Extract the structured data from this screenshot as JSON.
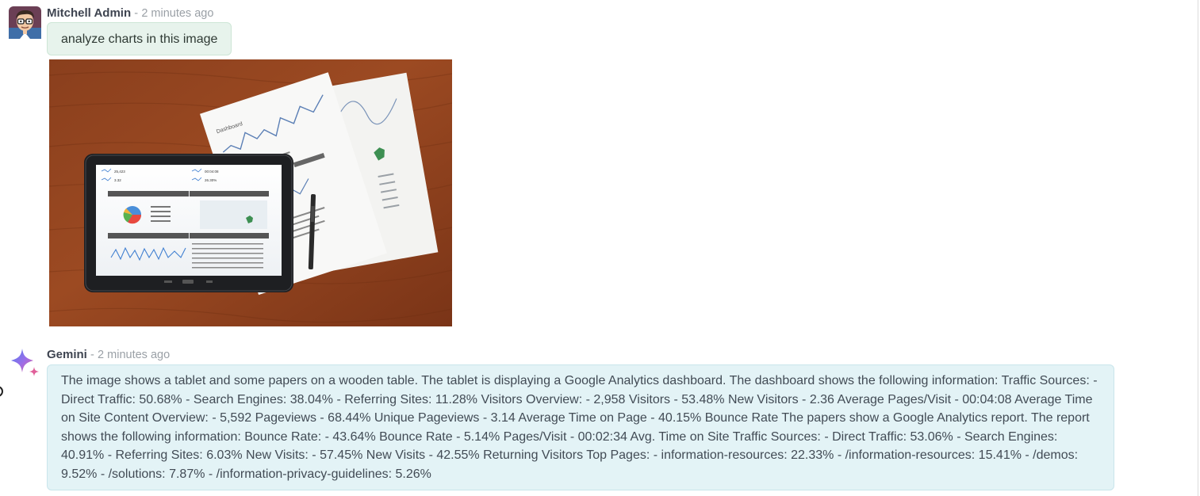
{
  "messages": {
    "user": {
      "author": "Mitchell Admin",
      "separator": "-",
      "time": "2 minutes ago",
      "text": "analyze charts in this image"
    },
    "assistant": {
      "author": "Gemini",
      "separator": "-",
      "time": "2 minutes ago",
      "text": "The image shows a tablet and some papers on a wooden table. The tablet is displaying a Google Analytics dashboard. The dashboard shows the following information: Traffic Sources: - Direct Traffic: 50.68% - Search Engines: 38.04% - Referring Sites: 11.28% Visitors Overview: - 2,958 Visitors - 53.48% New Visitors - 2.36 Average Pages/Visit - 00:04:08 Average Time on Site Content Overview: - 5,592 Pageviews - 68.44% Unique Pageviews - 3.14 Average Time on Page - 40.15% Bounce Rate The papers show a Google Analytics report. The report shows the following information: Bounce Rate: - 43.64% Bounce Rate - 5.14% Pages/Visit - 00:02:34 Avg. Time on Site Traffic Sources: - Direct Traffic: 53.06% - Search Engines: 40.91% - Referring Sites: 6.03% New Visits: - 57.45% New Visits - 42.55% Returning Visitors Top Pages: - information-resources: 22.33% - /information-resources: 15.41% - /demos: 9.52% - /solutions: 7.87% - /information-privacy-guidelines: 5.26%"
    }
  },
  "attachment": {
    "photo_icon": "tablet-with-analytics-dashboard-on-wooden-table-photo",
    "tablet_stats": [
      "25,423",
      "00:04:08",
      "3.32",
      "26.30%"
    ],
    "paper_title": "Dashboard"
  },
  "colors": {
    "user_bubble": "#e7f3ec",
    "assistant_bubble": "#e3f3f6",
    "author_text": "#3e4450",
    "timestamp_text": "#9aa0a6"
  }
}
